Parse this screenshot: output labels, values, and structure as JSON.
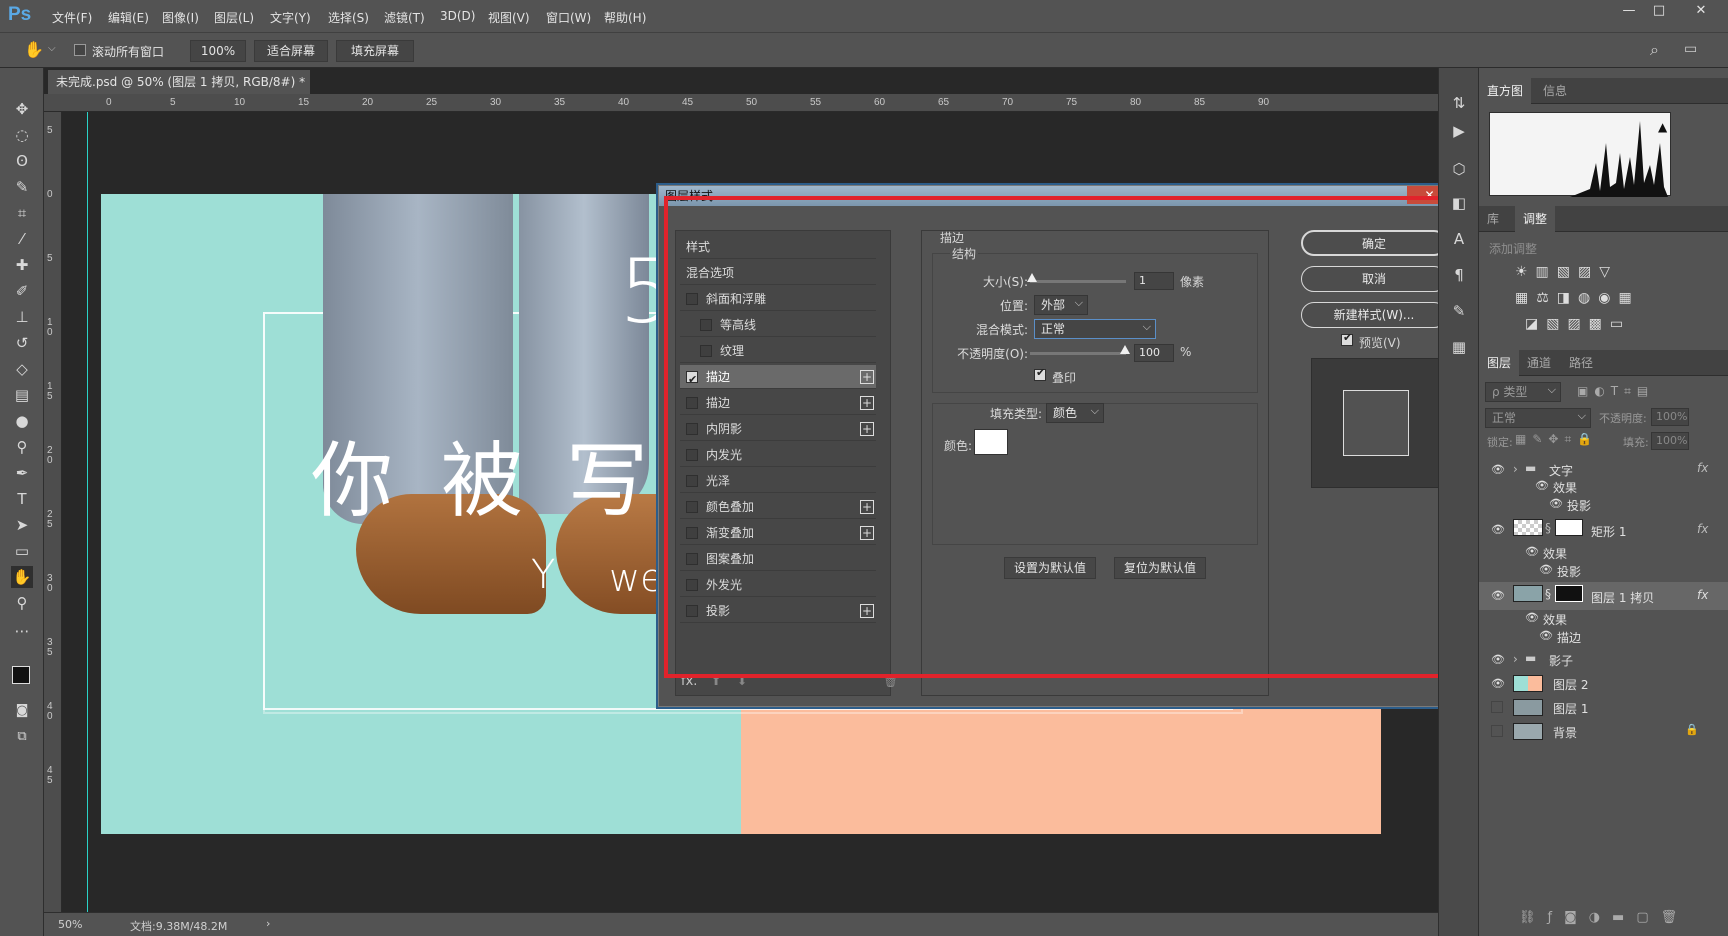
{
  "app": {
    "logo": "Ps"
  },
  "menu": [
    "文件(F)",
    "编辑(E)",
    "图像(I)",
    "图层(L)",
    "文字(Y)",
    "选择(S)",
    "滤镜(T)",
    "3D(D)",
    "视图(V)",
    "窗口(W)",
    "帮助(H)"
  ],
  "options": {
    "scroll_all": "滚动所有窗口",
    "zoom": "100%",
    "fit_screen": "适合屏幕",
    "fill_screen": "填充屏幕"
  },
  "document": {
    "tab_title": "未完成.psd @ 50% (图层 1 拷贝, RGB/8#) *",
    "zoom": "50%",
    "doc_info": "文档:9.38M/48.2M"
  },
  "ruler_h": [
    "0",
    "5",
    "10",
    "15",
    "20",
    "25",
    "30",
    "35",
    "40",
    "45",
    "50",
    "55",
    "60",
    "65",
    "70",
    "75",
    "80",
    "85",
    "90"
  ],
  "ruler_v": [
    "5",
    "0",
    "5",
    "1\n0",
    "1\n5",
    "2\n0",
    "2\n5",
    "3\n0",
    "3\n5",
    "4\n0",
    "4\n5"
  ],
  "canvas_text": {
    "number": "5",
    "chars": [
      "你",
      "被",
      "写"
    ],
    "y": "Y",
    "we": "we"
  },
  "panels": {
    "top_tabs": [
      "直方图",
      "信息"
    ],
    "adjust_tabs": [
      "库",
      "调整"
    ],
    "add_adjust": "添加调整",
    "layer_tabs": [
      "图层",
      "通道",
      "路径"
    ],
    "filter_placeholder": "ρ 类型",
    "blend_mode": "正常",
    "opacity_label": "不透明度:",
    "opacity_value": "100%",
    "lock_label": "锁定:",
    "fill_label": "填充:",
    "fill_value": "100%"
  },
  "layers": [
    {
      "name": "文字",
      "kind": "group",
      "fx": "fx"
    },
    {
      "name": "效果",
      "kind": "effects"
    },
    {
      "name": "投影",
      "kind": "effect"
    },
    {
      "name": "矩形 1",
      "kind": "layer",
      "fx": "fx"
    },
    {
      "name": "效果",
      "kind": "effects"
    },
    {
      "name": "投影",
      "kind": "effect"
    },
    {
      "name": "图层 1 拷贝",
      "kind": "layer",
      "fx": "fx"
    },
    {
      "name": "效果",
      "kind": "effects"
    },
    {
      "name": "描边",
      "kind": "effect"
    },
    {
      "name": "影子",
      "kind": "group"
    },
    {
      "name": "图层 2",
      "kind": "layer"
    },
    {
      "name": "图层 1",
      "kind": "layer"
    },
    {
      "name": "背景",
      "kind": "layer"
    }
  ],
  "dialog": {
    "title": "图层样式",
    "style_items": [
      {
        "label": "样式",
        "checkbox": false,
        "plus": false,
        "indent": 0,
        "checked": false
      },
      {
        "label": "混合选项",
        "checkbox": false,
        "plus": false,
        "indent": 0,
        "checked": false
      },
      {
        "label": "斜面和浮雕",
        "checkbox": true,
        "plus": false,
        "indent": 0,
        "checked": false
      },
      {
        "label": "等高线",
        "checkbox": true,
        "plus": false,
        "indent": 1,
        "checked": false
      },
      {
        "label": "纹理",
        "checkbox": true,
        "plus": false,
        "indent": 1,
        "checked": false
      },
      {
        "label": "描边",
        "checkbox": true,
        "plus": true,
        "indent": 0,
        "checked": true
      },
      {
        "label": "描边",
        "checkbox": true,
        "plus": true,
        "indent": 0,
        "checked": false
      },
      {
        "label": "内阴影",
        "checkbox": true,
        "plus": true,
        "indent": 0,
        "checked": false
      },
      {
        "label": "内发光",
        "checkbox": true,
        "plus": false,
        "indent": 0,
        "checked": false
      },
      {
        "label": "光泽",
        "checkbox": true,
        "plus": false,
        "indent": 0,
        "checked": false
      },
      {
        "label": "颜色叠加",
        "checkbox": true,
        "plus": true,
        "indent": 0,
        "checked": false
      },
      {
        "label": "渐变叠加",
        "checkbox": true,
        "plus": true,
        "indent": 0,
        "checked": false
      },
      {
        "label": "图案叠加",
        "checkbox": true,
        "plus": false,
        "indent": 0,
        "checked": false
      },
      {
        "label": "外发光",
        "checkbox": true,
        "plus": false,
        "indent": 0,
        "checked": false
      },
      {
        "label": "投影",
        "checkbox": true,
        "plus": true,
        "indent": 0,
        "checked": false
      }
    ],
    "section": "描边",
    "structure": "结构",
    "size_label": "大小(S):",
    "size_value": "1",
    "size_unit": "像素",
    "position_label": "位置:",
    "position_value": "外部",
    "blend_label": "混合模式:",
    "blend_value": "正常",
    "opacity_label": "不透明度(O):",
    "opacity_value": "100",
    "opacity_unit": "%",
    "overprint": "叠印",
    "fill_type_label": "填充类型:",
    "fill_type_value": "颜色",
    "color_label": "颜色:",
    "color_value": "#ffffff",
    "set_default": "设置为默认值",
    "reset_default": "复位为默认值",
    "ok": "确定",
    "cancel": "取消",
    "new_style": "新建样式(W)...",
    "preview": "预览(V)",
    "fx_label": "fx."
  },
  "colors": {
    "accent_highlight": "#e1232b",
    "teal": "#9edfd6",
    "peach": "#fbbc9c"
  }
}
